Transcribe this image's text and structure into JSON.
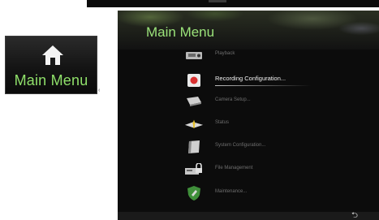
{
  "shortcut_tile": {
    "label": "Main Menu",
    "icon": "home-icon",
    "color": "#8fe06a"
  },
  "separator_mark": "‹",
  "main_menu": {
    "title": "Main Menu",
    "items": [
      {
        "label": "Playback",
        "icon": "playback-icon"
      },
      {
        "label": "Recording Configuration...",
        "icon": "record-icon",
        "selected": true
      },
      {
        "label": "Camera Setup...",
        "icon": "camera-icon"
      },
      {
        "label": "Status",
        "icon": "status-icon"
      },
      {
        "label": "System Configuration...",
        "icon": "system-icon"
      },
      {
        "label": "File Management",
        "icon": "file-management-icon"
      },
      {
        "label": "Maintenance...",
        "icon": "maintenance-icon"
      }
    ],
    "back_glyph": "⮌"
  }
}
